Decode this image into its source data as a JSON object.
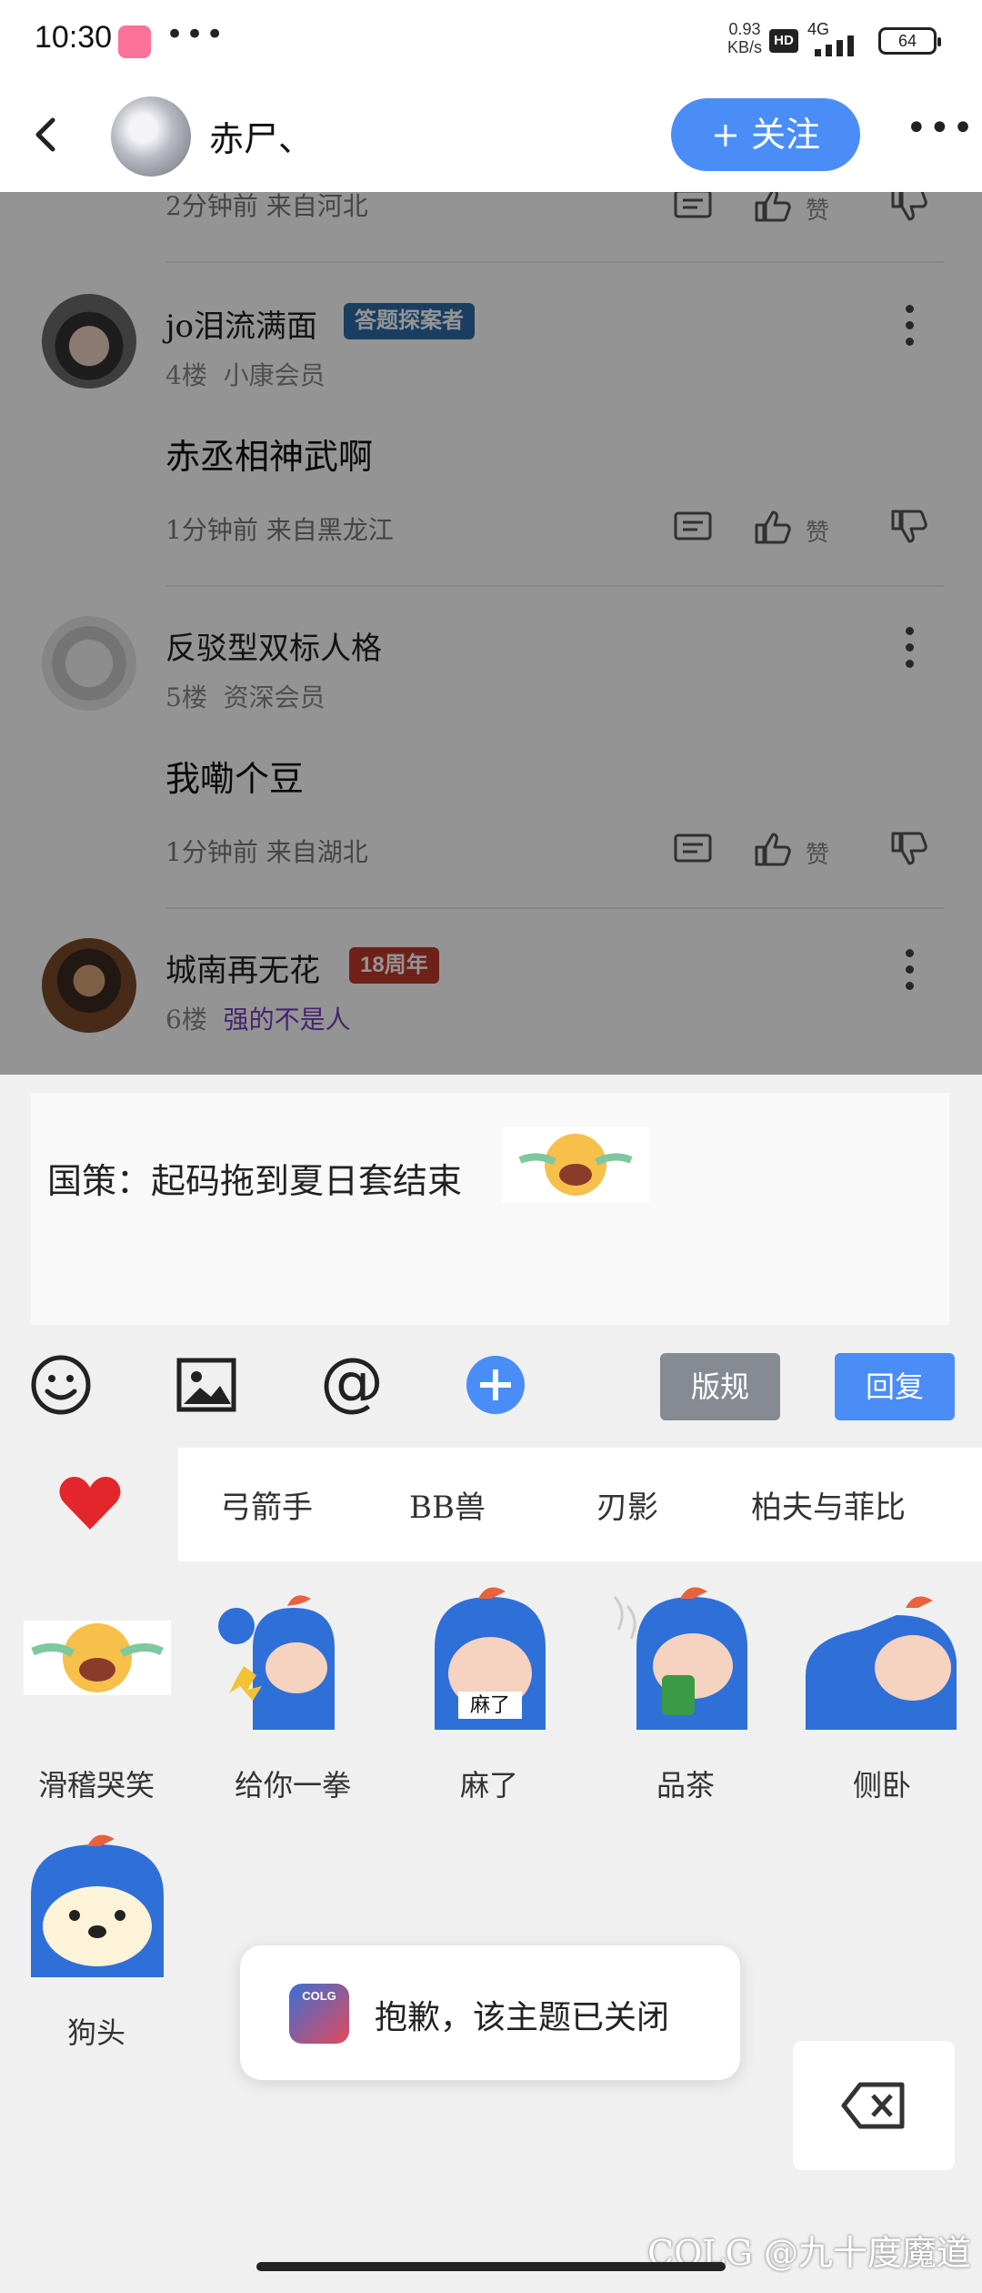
{
  "status_bar": {
    "time": "10:30",
    "more": "•••",
    "speed_value": "0.93",
    "speed_unit": "KB/s",
    "hd": "HD",
    "network": "4G",
    "battery": "64"
  },
  "header": {
    "username": "赤尸、",
    "follow_label": "+ 关注",
    "more": "•••"
  },
  "feed": {
    "partial_meta": "2分钟前 来自河北",
    "like_label": "赞",
    "posts": [
      {
        "name": "jo泪流满面",
        "badge": "答题探案者",
        "floor": "4楼",
        "rank": "小康会员",
        "content": "赤丞相神武啊",
        "meta": "1分钟前 来自黑龙江"
      },
      {
        "name": "反驳型双标人格",
        "floor": "5楼",
        "rank": "资深会员",
        "content": "我嘞个豆",
        "meta": "1分钟前 来自湖北"
      },
      {
        "name": "城南再无花",
        "badge": "18周年",
        "floor": "6楼",
        "rank": "强的不是人"
      }
    ]
  },
  "reply": {
    "input_text": "国策：起码拖到夏日套结束",
    "rules_label": "版规",
    "reply_label": "回复"
  },
  "sticker_tabs": [
    "弓箭手",
    "BB兽",
    "刃影",
    "柏夫与菲比"
  ],
  "stickers": [
    "滑稽哭笑",
    "给你一拳",
    "麻了",
    "品茶",
    "侧卧",
    "狗头"
  ],
  "sticker_captions": {
    "mala": "麻了"
  },
  "toast": {
    "message": "抱歉，该主题已关闭",
    "logo_text": "COLG"
  },
  "watermark": "COLG @九十度魔道",
  "colors": {
    "accent": "#4a8df7",
    "rules_button": "#868a92",
    "heart": "#e3262b",
    "rank_purple": "#7a3fc0"
  }
}
